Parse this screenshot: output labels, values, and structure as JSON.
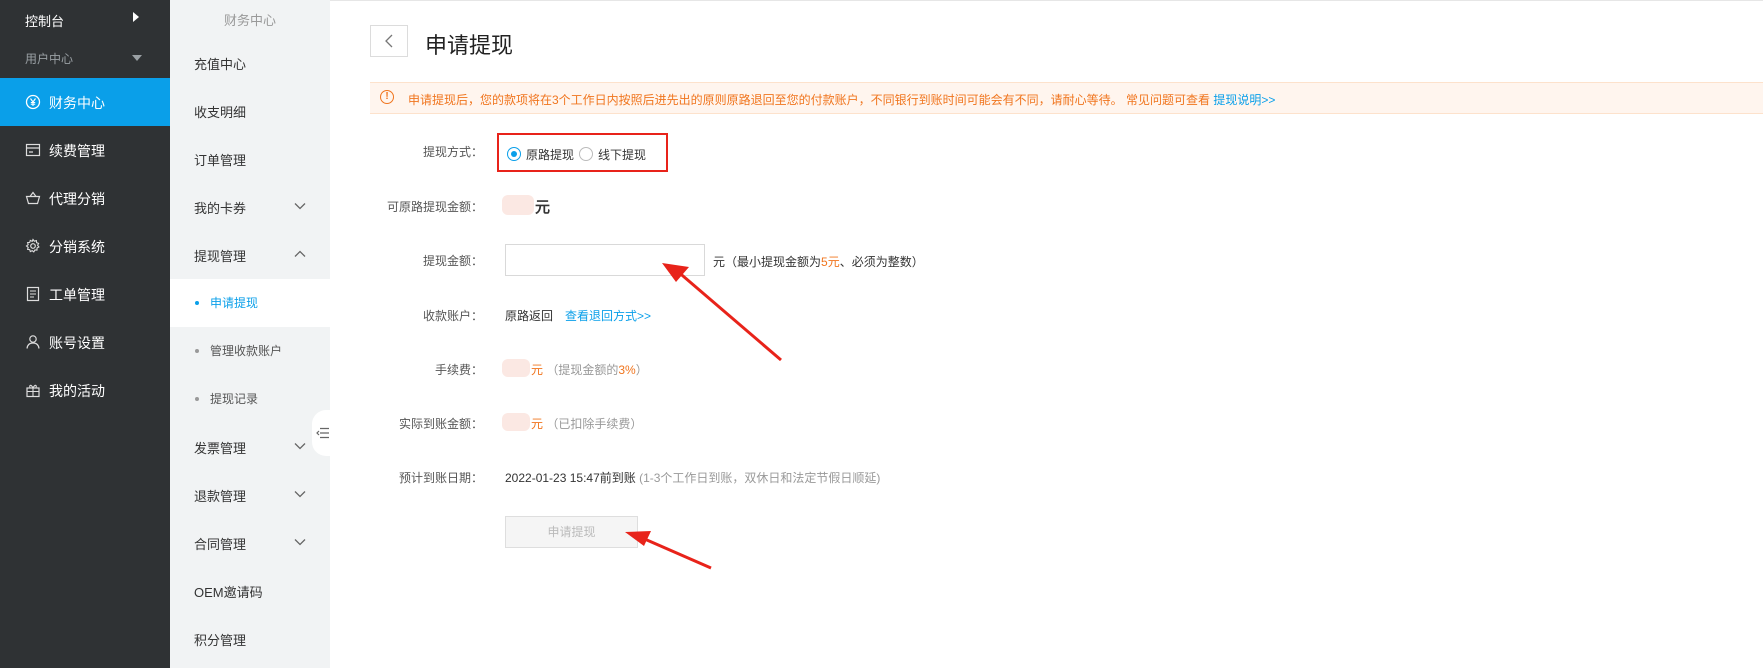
{
  "sidebar": {
    "console": "控制台",
    "user_center": "用户中心",
    "items": [
      {
        "label": "财务中心",
        "icon": "yen-circle-icon"
      },
      {
        "label": "续费管理",
        "icon": "card-icon"
      },
      {
        "label": "代理分销",
        "icon": "basket-icon"
      },
      {
        "label": "分销系统",
        "icon": "gear-icon"
      },
      {
        "label": "工单管理",
        "icon": "document-icon"
      },
      {
        "label": "账号设置",
        "icon": "user-icon"
      },
      {
        "label": "我的活动",
        "icon": "gift-icon"
      }
    ]
  },
  "submenu": {
    "title": "财务中心",
    "items": [
      {
        "label": "充值中心"
      },
      {
        "label": "收支明细"
      },
      {
        "label": "订单管理"
      },
      {
        "label": "我的卡券"
      },
      {
        "label": "提现管理"
      },
      {
        "label": "申请提现"
      },
      {
        "label": "管理收款账户"
      },
      {
        "label": "提现记录"
      },
      {
        "label": "发票管理"
      },
      {
        "label": "退款管理"
      },
      {
        "label": "合同管理"
      },
      {
        "label": "OEM邀请码"
      },
      {
        "label": "积分管理"
      }
    ]
  },
  "page": {
    "title": "申请提现",
    "notice": {
      "text": "申请提现后，您的款项将在3个工作日内按照后进先出的原则原路退回至您的付款账户，不同银行到账时间可能会有不同，请耐心等待。 常见问题可查看",
      "link": "提现说明>>"
    },
    "form": {
      "method_label": "提现方式：",
      "method_options": [
        "原路提现",
        "线下提现"
      ],
      "method_selected": "原路提现",
      "available_label": "可原路提现金额：",
      "available_unit": "元",
      "amount_label": "提现金额：",
      "amount_value": "",
      "amount_unit": "元",
      "amount_hint_prefix": "（最小提现金额为",
      "amount_hint_min": "5元",
      "amount_hint_suffix": "、必须为整数）",
      "account_label": "收款账户：",
      "account_value": "原路返回",
      "account_link": "查看退回方式>>",
      "fee_label": "手续费：",
      "fee_unit": "元",
      "fee_hint_prefix": "（提现金额的",
      "fee_hint_rate": "3%",
      "fee_hint_suffix": "）",
      "actual_label": "实际到账金额：",
      "actual_unit": "元",
      "actual_hint": "（已扣除手续费）",
      "date_label": "预计到账日期：",
      "date_value": "2022-01-23 15:47前到账",
      "date_hint": "(1-3个工作日到账，双休日和法定节假日顺延)",
      "submit": "申请提现"
    }
  },
  "colors": {
    "sidebar_bg": "#2f3234",
    "accent": "#0a9fe9",
    "warning": "#f0751e",
    "annotation": "#e8231a"
  }
}
